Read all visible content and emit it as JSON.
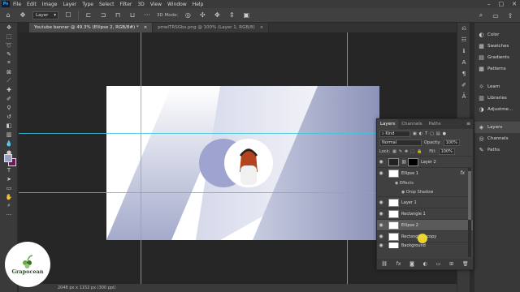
{
  "menubar": {
    "logo": "Ps",
    "items": [
      "File",
      "Edit",
      "Image",
      "Layer",
      "Type",
      "Select",
      "Filter",
      "3D",
      "View",
      "Window",
      "Help"
    ],
    "window_controls": [
      "–",
      "□",
      "✕"
    ]
  },
  "options_bar": {
    "layer_select": "Layer",
    "mode_3d": "3D Mode:"
  },
  "tabs": [
    {
      "label": "Youtube banner @ 49.3% (Ellipse 2, RGB/8#) *",
      "close": "×"
    },
    {
      "label": "pmeITRSGbs.png @ 100% (Layer 1, RGB/8)",
      "close": "×"
    }
  ],
  "statusbar": {
    "text": "2048 px x 1152 px (300 ppi)"
  },
  "right_dock": {
    "group1": [
      {
        "icon": "color-icon",
        "glyph": "◐",
        "label": "Color"
      },
      {
        "icon": "swatches-icon",
        "glyph": "▦",
        "label": "Swatches"
      },
      {
        "icon": "gradients-icon",
        "glyph": "▤",
        "label": "Gradients"
      },
      {
        "icon": "patterns-icon",
        "glyph": "▩",
        "label": "Patterns"
      }
    ],
    "group2": [
      {
        "icon": "learn-icon",
        "glyph": "☼",
        "label": "Learn"
      },
      {
        "icon": "libraries-icon",
        "glyph": "▥",
        "label": "Libraries"
      },
      {
        "icon": "adjustments-icon",
        "glyph": "◑",
        "label": "Adjustme..."
      }
    ],
    "group3": [
      {
        "icon": "layers-icon",
        "glyph": "◈",
        "label": "Layers"
      },
      {
        "icon": "channels-icon",
        "glyph": "◎",
        "label": "Channels"
      },
      {
        "icon": "paths-icon",
        "glyph": "✎",
        "label": "Paths"
      }
    ]
  },
  "layers_panel": {
    "tabs": [
      "Layers",
      "Channels",
      "Paths"
    ],
    "menu": "≡",
    "kind_filter": "Kind",
    "blend_mode": "Normal",
    "opacity_label": "Opacity:",
    "opacity_value": "100%",
    "lock_label": "Lock:",
    "fill_label": "Fill:",
    "fill_value": "100%",
    "layers": [
      {
        "name": "Layer 2",
        "thumb": "dark",
        "mask": true,
        "fx": false,
        "selected": false
      },
      {
        "name": "Ellipse 1",
        "thumb": "light",
        "mask": false,
        "fx": true,
        "selected": false
      },
      {
        "name": "Layer 1",
        "thumb": "light",
        "mask": false,
        "fx": false,
        "selected": false
      },
      {
        "name": "Rectangle 1",
        "thumb": "light",
        "mask": false,
        "fx": false,
        "selected": false
      },
      {
        "name": "Ellipse 2",
        "thumb": "light",
        "mask": false,
        "fx": false,
        "selected": true
      },
      {
        "name": "Rectangle 1 copy",
        "thumb": "light",
        "mask": false,
        "fx": false,
        "selected": false
      },
      {
        "name": "Background",
        "thumb": "light",
        "mask": false,
        "fx": false,
        "selected": false
      }
    ],
    "effects_label": "Effects",
    "effect_item": "Drop Shadow",
    "fx_glyph": "fx"
  },
  "logo": {
    "text": "Grapocean"
  },
  "colors": {
    "foreground": "#9a9fc4",
    "background": "#6b1a55",
    "guide": "#37c8e0",
    "stripe": "#aeb3cf"
  }
}
